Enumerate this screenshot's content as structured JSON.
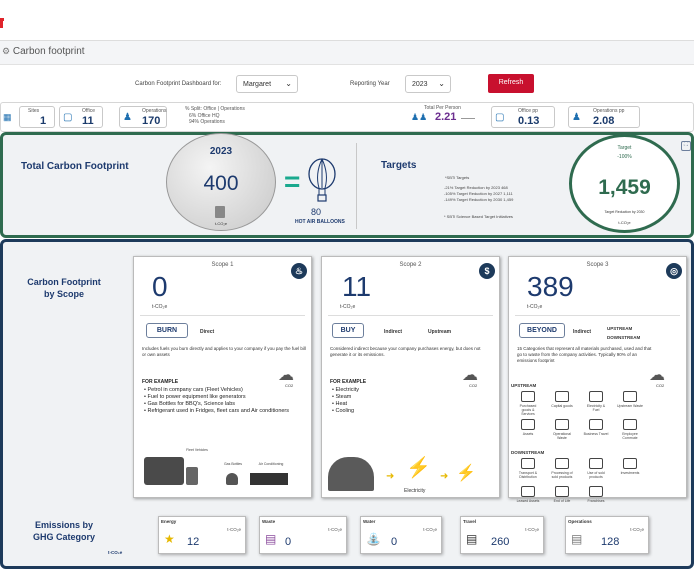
{
  "header": {
    "page_title": "Carbon footprint",
    "page_icon": "gear-icon"
  },
  "filters": {
    "dashboard_label": "Carbon Footprint Dashboard for:",
    "dashboard_value": "Margaret",
    "year_label": "Reporting Year",
    "year_value": "2023",
    "refresh_label": "Refresh"
  },
  "stats": {
    "sites_label": "Sites",
    "sites_value": "1",
    "office_label": "Office",
    "office_value": "11",
    "operations_label": "Operations",
    "operations_value": "170",
    "split_title": "% Split: Office | Operations",
    "split_office": "6% Office HQ",
    "split_ops": "94% Operations",
    "per_person_label": "Total Per Person",
    "per_person_value": "2.21",
    "office_pp_label": "Office pp",
    "office_pp_value": "0.13",
    "ops_pp_label": "Operations pp",
    "ops_pp_value": "2.08"
  },
  "total": {
    "title": "Total Carbon Footprint",
    "year": "2023",
    "value": "400",
    "unit": "t-CO₂e",
    "balloons_value": "80",
    "balloons_label": "HOT AIR BALLOONS",
    "targets_title": "Targets",
    "targets_heading": "*SBTi Targets",
    "target_lines": [
      "-21% Target Reduction by 2023    468",
      "-105% Target Reduction by 2027    1,111",
      "-149% Target Reduction by 2030    1,459"
    ],
    "targets_note": "* SBTi Science Based Target Initiatives",
    "target_circle_label": "Target",
    "target_circle_pct": "-100%",
    "target_circle_value": "1,459",
    "target_circle_sub": "Target Reduction by 2030",
    "target_circle_unit": "t-CO₂e"
  },
  "scope_section": {
    "title": "Carbon Footprint by Scope"
  },
  "scopes": [
    {
      "header": "Scope 1",
      "value": "0",
      "unit": "t-CO₂e",
      "pill": "BURN",
      "tag1": "Direct",
      "tag2": "",
      "desc": "Includes fuels you burn directly and applies to your company if you pay the fuel bill or own assets",
      "example_title": "FOR EXAMPLE",
      "examples": [
        "Petrol in company cars (Fleet Vehicles)",
        "Fuel to power equipment like generators",
        "Gas Bottles for BBQ's, Science labs",
        "Refrigerant used in Fridges, fleet cars and Air conditioners"
      ],
      "co2": "CO2",
      "icon": "flame-icon",
      "img_labels": [
        "Fleet Vehicles",
        "Gas Bottles",
        "Air Conditioning"
      ]
    },
    {
      "header": "Scope 2",
      "value": "11",
      "unit": "t-CO₂e",
      "pill": "BUY",
      "tag1": "Indirect",
      "tag2": "Upstream",
      "desc": "Considered indirect because your company purchases energy, but does not generate it or its emissions.",
      "example_title": "FOR EXAMPLE",
      "examples": [
        "Electricity",
        "Steam",
        "Heat",
        "Cooling"
      ],
      "co2": "CO2",
      "icon": "dollar-icon",
      "img_labels": [
        "Electricity"
      ]
    },
    {
      "header": "Scope 3",
      "value": "389",
      "unit": "t-CO₂e",
      "pill": "BEYOND",
      "tag1": "Indirect",
      "tag2": "UPSTREAM DOWNSTREAM",
      "desc": "15 Categories that represent all materials purchased, used and that go to waste from the company activities. Typically 90% of an emissions footprint",
      "example_title": "",
      "examples": [],
      "co2": "CO2",
      "icon": "globe-icon",
      "upstream": "UPSTREAM",
      "downstream": "DOWNSTREAM",
      "up_items": [
        "Purchased goods & Services",
        "Capital goods",
        "Electricity & Fuel",
        "Upstream Waste",
        "Assets",
        "Operational Waste",
        "Business Travel",
        "Employee Commute"
      ],
      "down_items": [
        "Transport & Distribution",
        "Processing of sold products",
        "Use of sold products",
        "Investments",
        "Leased Assets",
        "End of Life",
        "Franchises"
      ]
    }
  ],
  "ghg": {
    "title": "Emissions by GHG Category",
    "unit": "t-CO₂e",
    "items": [
      {
        "label": "Energy",
        "value": "12",
        "unit": "t-CO₂e"
      },
      {
        "label": "Waste",
        "value": "0",
        "unit": "t-CO₂e"
      },
      {
        "label": "Water",
        "value": "0",
        "unit": "t-CO₂e"
      },
      {
        "label": "Travel",
        "value": "260",
        "unit": "t-CO₂e"
      },
      {
        "label": "Operations",
        "value": "128",
        "unit": "t-CO₂e"
      }
    ]
  }
}
